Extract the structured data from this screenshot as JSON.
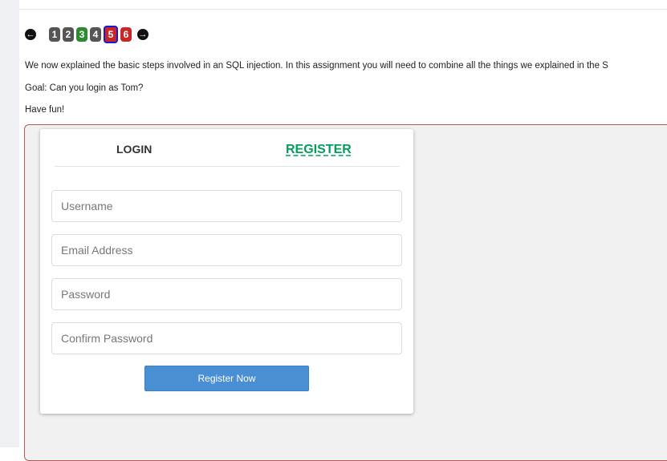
{
  "pagination": {
    "prev_icon": "arrow-left-icon",
    "next_icon": "arrow-right-icon",
    "pages": [
      {
        "label": "1",
        "status": "grey"
      },
      {
        "label": "2",
        "status": "grey"
      },
      {
        "label": "3",
        "status": "green"
      },
      {
        "label": "4",
        "status": "grey"
      },
      {
        "label": "5",
        "status": "red",
        "current": true
      },
      {
        "label": "6",
        "status": "red"
      }
    ]
  },
  "content": {
    "intro": "We now explained the basic steps involved in an SQL injection. In this assignment you will need to combine all the things we explained in the S",
    "goal": "Goal: Can you login as Tom?",
    "fun": "Have fun!"
  },
  "form": {
    "tabs": {
      "login": "LOGIN",
      "register": "REGISTER"
    },
    "fields": {
      "username": "Username",
      "email": "Email Address",
      "password": "Password",
      "confirm": "Confirm Password"
    },
    "submit": "Register Now"
  },
  "colors": {
    "register_tab": "#029f5b",
    "submit_button": "#4a8fd4",
    "attack_border": "#b05a5a",
    "page_green": "#2e8b2e",
    "page_red": "#c62828",
    "page_grey": "#555555"
  }
}
